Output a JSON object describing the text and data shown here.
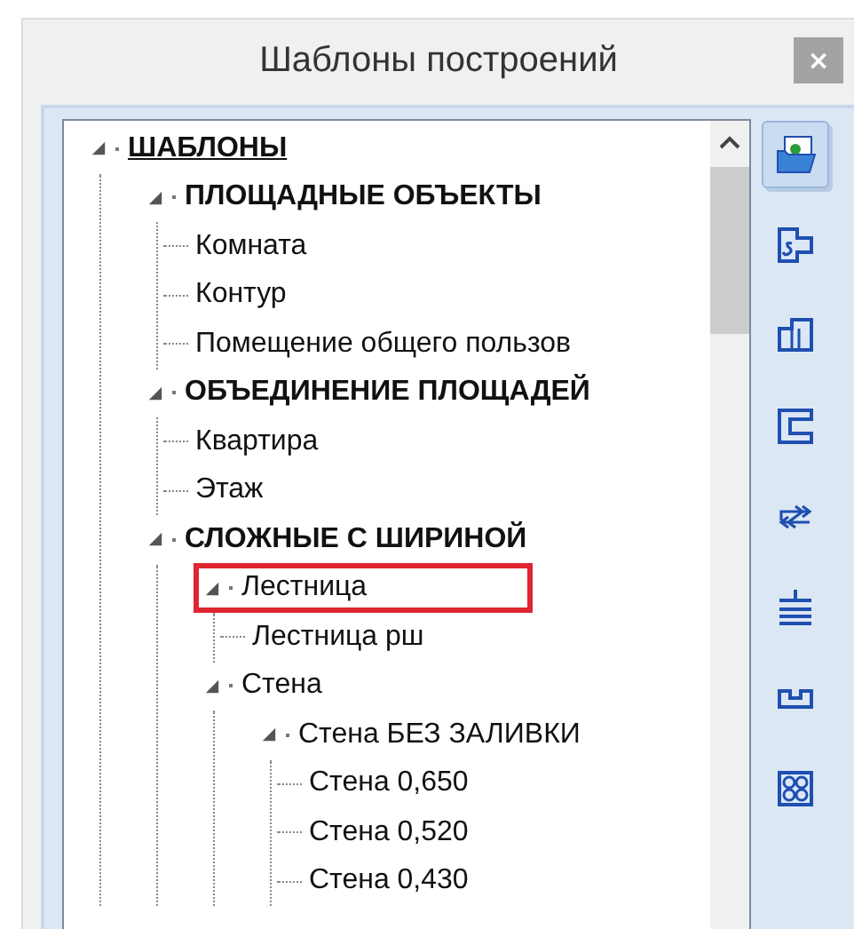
{
  "window": {
    "title": "Шаблоны построений",
    "close": "×"
  },
  "tree": [
    {
      "label": "ШАБЛОНЫ",
      "kind": "root",
      "expanded": true,
      "highlighted": false,
      "children": [
        {
          "label": "ПЛОЩАДНЫЕ ОБЪЕКТЫ",
          "kind": "group",
          "expanded": true,
          "highlighted": false,
          "children": [
            {
              "label": "Комната",
              "highlighted": false
            },
            {
              "label": "Контур",
              "highlighted": false
            },
            {
              "label": "Помещение общего пользов",
              "highlighted": false
            }
          ]
        },
        {
          "label": "ОБЪЕДИНЕНИЕ ПЛОЩАДЕЙ",
          "kind": "group",
          "expanded": true,
          "highlighted": false,
          "children": [
            {
              "label": "Квартира",
              "highlighted": false
            },
            {
              "label": "Этаж",
              "highlighted": false
            }
          ]
        },
        {
          "label": "СЛОЖНЫЕ С ШИРИНОЙ",
          "kind": "group",
          "expanded": true,
          "highlighted": false,
          "children": [
            {
              "label": "Лестница",
              "kind": "folder",
              "expanded": true,
              "highlighted": true,
              "children": [
                {
                  "label": "Лестница рш",
                  "highlighted": false
                }
              ]
            },
            {
              "label": "Стена",
              "kind": "folder",
              "expanded": true,
              "highlighted": false,
              "children": [
                {
                  "label": "Стена БЕЗ ЗАЛИВКИ",
                  "kind": "folder",
                  "expanded": true,
                  "highlighted": false,
                  "children": [
                    {
                      "label": "Стена 0,650",
                      "highlighted": false
                    },
                    {
                      "label": "Стена 0,520",
                      "highlighted": false
                    },
                    {
                      "label": "Стена 0,430",
                      "highlighted": false
                    }
                  ]
                }
              ]
            }
          ]
        }
      ]
    }
  ],
  "toolbar": [
    {
      "kind": "open",
      "selected": true
    },
    {
      "kind": "area",
      "selected": false
    },
    {
      "kind": "areas",
      "selected": false
    },
    {
      "kind": "wall",
      "selected": false
    },
    {
      "kind": "arrows",
      "selected": false
    },
    {
      "kind": "stair",
      "selected": false
    },
    {
      "kind": "niche",
      "selected": false
    },
    {
      "kind": "grid",
      "selected": false
    }
  ]
}
